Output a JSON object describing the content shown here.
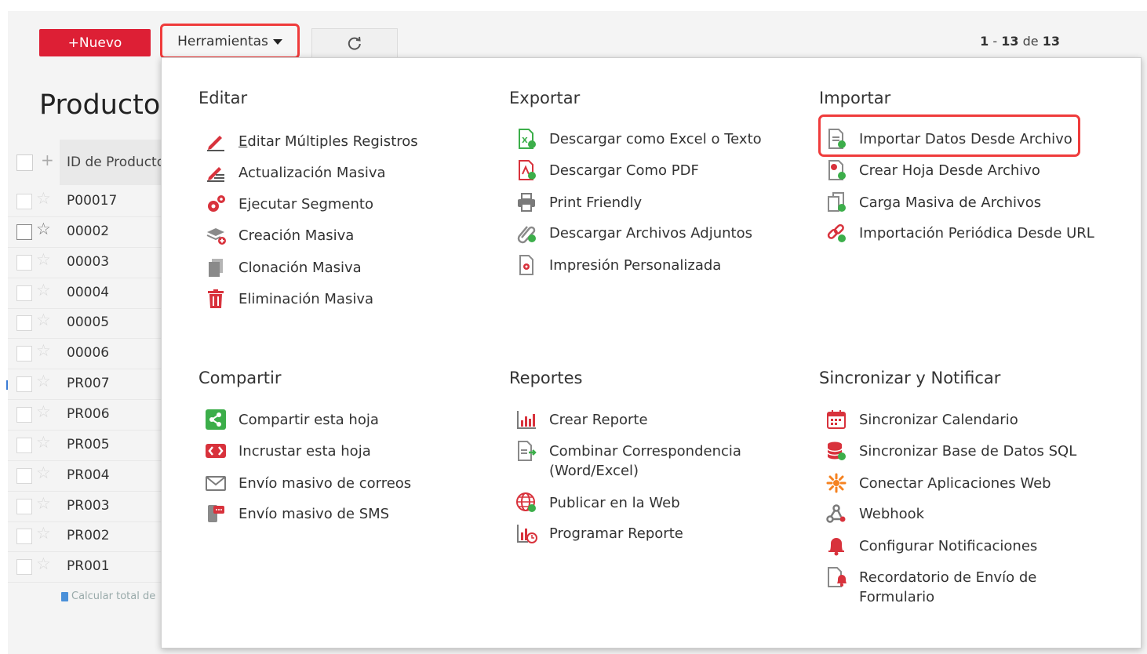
{
  "toolbar": {
    "new_label": "+Nuevo",
    "tools_label": "Herramientas",
    "pager": {
      "from": "1",
      "sep": "-",
      "to": "13",
      "of": "de",
      "total": "13"
    }
  },
  "page": {
    "title": "Productos",
    "column_header": "ID de Producto",
    "rows": [
      "P00017",
      "00002",
      "00003",
      "00004",
      "00005",
      "00006",
      "PR007",
      "PR006",
      "PR005",
      "PR004",
      "PR003",
      "PR002",
      "PR001"
    ],
    "footer": "Calcular total de"
  },
  "menu": {
    "editar": {
      "title": "Editar",
      "items": [
        "Editar Múltiples Registros",
        "Actualización Masiva",
        "Ejecutar Segmento",
        "Creación Masiva",
        "Clonación Masiva",
        "Eliminación Masiva"
      ]
    },
    "exportar": {
      "title": "Exportar",
      "items": [
        "Descargar como Excel o Texto",
        "Descargar Como PDF",
        "Print Friendly",
        "Descargar Archivos Adjuntos",
        "Impresión Personalizada"
      ]
    },
    "importar": {
      "title": "Importar",
      "items": [
        "Importar Datos Desde Archivo",
        "Crear Hoja Desde Archivo",
        "Carga Masiva de Archivos",
        "Importación Periódica Desde URL"
      ]
    },
    "compartir": {
      "title": "Compartir",
      "items": [
        "Compartir esta hoja",
        "Incrustar esta hoja",
        "Envío masivo de correos",
        "Envío masivo de SMS"
      ]
    },
    "reportes": {
      "title": "Reportes",
      "items": [
        "Crear Reporte",
        "Combinar Correspondencia (Word/Excel)",
        "Publicar en la Web",
        "Programar Reporte"
      ]
    },
    "sincronizar": {
      "title": "Sincronizar y Notificar",
      "items": [
        "Sincronizar Calendario",
        "Sincronizar Base de Datos SQL",
        "Conectar Aplicaciones Web",
        "Webhook",
        "Configurar Notificaciones",
        "Recordatorio de Envío de Formulario"
      ]
    }
  },
  "colors": {
    "accent": "#dd1f35",
    "highlight": "#ef3b3b",
    "green": "#3cae4a",
    "icon_gray": "#8a8a8a"
  }
}
